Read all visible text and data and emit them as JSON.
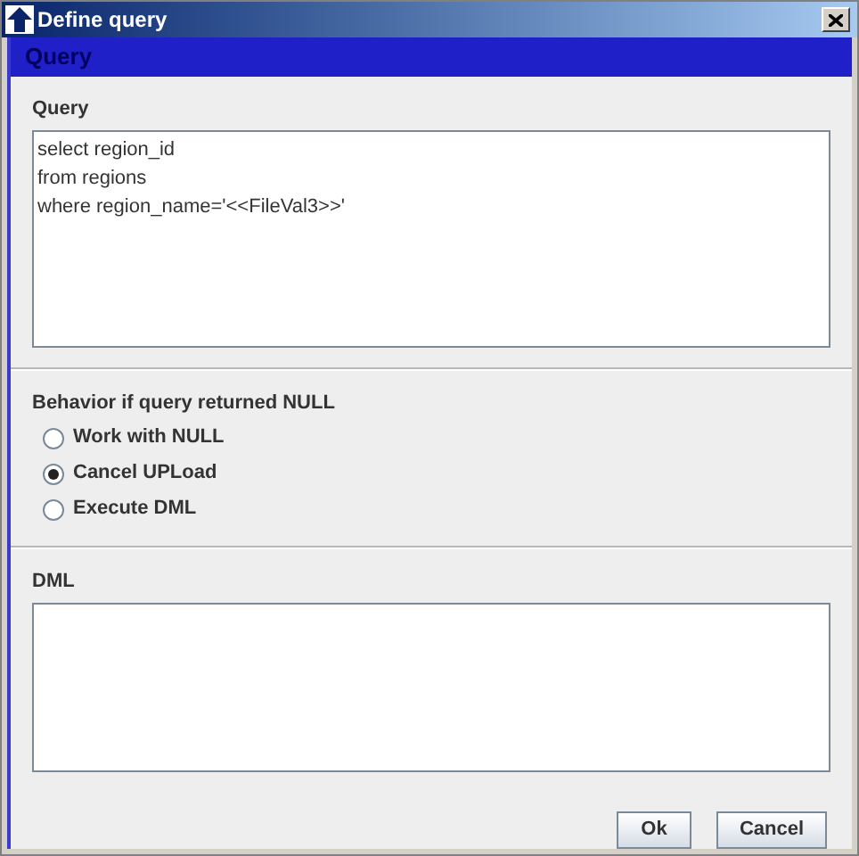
{
  "window": {
    "title": "Define query"
  },
  "header": {
    "title": "Query"
  },
  "query": {
    "label": "Query",
    "lines": [
      "select region_id",
      "from regions",
      "where region_name='<<FileVal3>>'"
    ]
  },
  "behavior": {
    "label": "Behavior if query returned NULL",
    "options": [
      {
        "label": "Work with NULL",
        "selected": false
      },
      {
        "label": "Cancel UPLoad",
        "selected": true
      },
      {
        "label": "Execute DML",
        "selected": false
      }
    ]
  },
  "dml": {
    "label": "DML"
  },
  "buttons": [
    "Ok",
    "Cancel"
  ]
}
